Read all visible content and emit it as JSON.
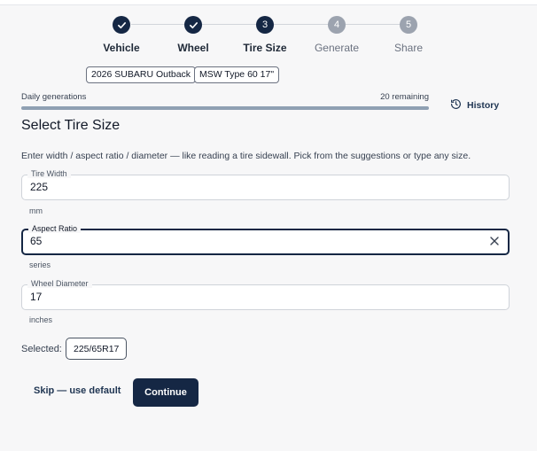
{
  "stepper": {
    "steps": [
      {
        "number": "1",
        "label": "Vehicle",
        "state": "done"
      },
      {
        "number": "2",
        "label": "Wheel",
        "state": "done"
      },
      {
        "number": "3",
        "label": "Tire Size",
        "state": "active"
      },
      {
        "number": "4",
        "label": "Generate",
        "state": "todo"
      },
      {
        "number": "5",
        "label": "Share",
        "state": "todo"
      }
    ]
  },
  "chips": {
    "vehicle": "2026 SUBARU Outback",
    "wheel": "MSW Type 60 17\""
  },
  "generations": {
    "label": "Daily generations",
    "remaining": "20 remaining",
    "fill_fraction": 1.0
  },
  "history_label": "History",
  "page_title": "Select Tire Size",
  "description": "Enter width / aspect ratio / diameter — like reading a tire sidewall. Pick from the suggestions or type any size.",
  "fields": {
    "width": {
      "label": "Tire Width",
      "value": "225",
      "helper": "mm"
    },
    "aspect": {
      "label": "Aspect Ratio",
      "value": "65",
      "helper": "series"
    },
    "diameter": {
      "label": "Wheel Diameter",
      "value": "17",
      "helper": "inches"
    }
  },
  "selected": {
    "label": "Selected:",
    "value": "225/65R17"
  },
  "actions": {
    "skip_label": "Skip — use default",
    "continue_label": "Continue"
  },
  "colors": {
    "primary": "#152744",
    "inactive_step": "#9ca3af",
    "background": "#f7f7f8"
  },
  "icons": {
    "check": "check-icon",
    "history": "history-icon",
    "clear": "close-icon"
  }
}
